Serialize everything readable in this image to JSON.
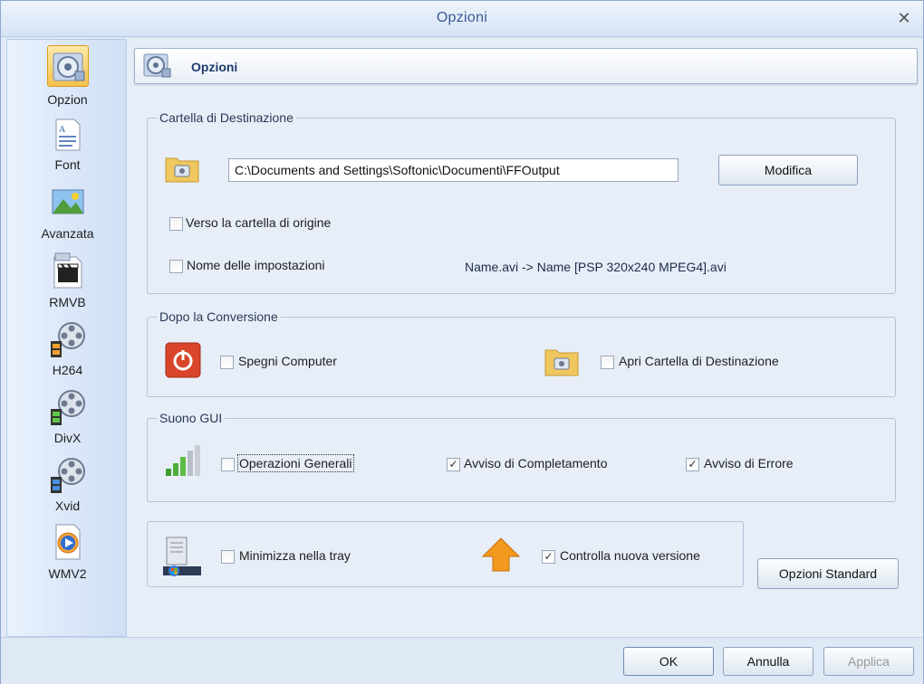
{
  "window": {
    "title": "Opzioni",
    "close_glyph": "✕"
  },
  "sidebar": {
    "items": [
      {
        "label": "Opzion",
        "icon": "settings-disc-icon",
        "active": true
      },
      {
        "label": "Font",
        "icon": "font-document-icon",
        "active": false
      },
      {
        "label": "Avanzata",
        "icon": "landscape-image-icon",
        "active": false
      },
      {
        "label": "RMVB",
        "icon": "clapperboard-icon",
        "active": false
      },
      {
        "label": "H264",
        "icon": "film-reel-icon",
        "active": false
      },
      {
        "label": "DivX",
        "icon": "film-reel-icon",
        "active": false
      },
      {
        "label": "Xvid",
        "icon": "film-reel-icon",
        "active": false
      },
      {
        "label": "WMV2",
        "icon": "media-player-icon",
        "active": false
      }
    ]
  },
  "header": {
    "title": "Opzioni"
  },
  "destination": {
    "legend": "Cartella di Destinazione",
    "path_value": "C:\\Documents and Settings\\Softonic\\Documenti\\FFOutput",
    "modify_label": "Modifica",
    "source_folder_label": "Verso la cartella di origine",
    "source_folder_checked": false,
    "settings_name_label": "Nome delle impostazioni",
    "settings_name_checked": false,
    "example_text": "Name.avi  -> Name [PSP 320x240 MPEG4].avi"
  },
  "after_conversion": {
    "legend": "Dopo la Conversione",
    "shutdown_label": "Spegni Computer",
    "shutdown_checked": false,
    "open_folder_label": "Apri Cartella di Destinazione",
    "open_folder_checked": false
  },
  "gui_sound": {
    "legend": "Suono GUI",
    "general_label": "Operazioni Generali",
    "general_checked": false,
    "completion_label": "Avviso di Completamento",
    "completion_checked": true,
    "error_label": "Avviso di Errore",
    "error_checked": true
  },
  "misc": {
    "tray_label": "Minimizza nella tray",
    "tray_checked": false,
    "update_label": "Controlla nuova versione",
    "update_checked": true,
    "standard_label": "Opzioni Standard"
  },
  "footer": {
    "ok_label": "OK",
    "cancel_label": "Annulla",
    "apply_label": "Applica"
  },
  "check_glyph": "✓",
  "colors": {
    "accent": "#3b5998",
    "shutdown_red": "#d9452a",
    "folder_yellow": "#f0c75e",
    "update_orange": "#f39a1e"
  }
}
